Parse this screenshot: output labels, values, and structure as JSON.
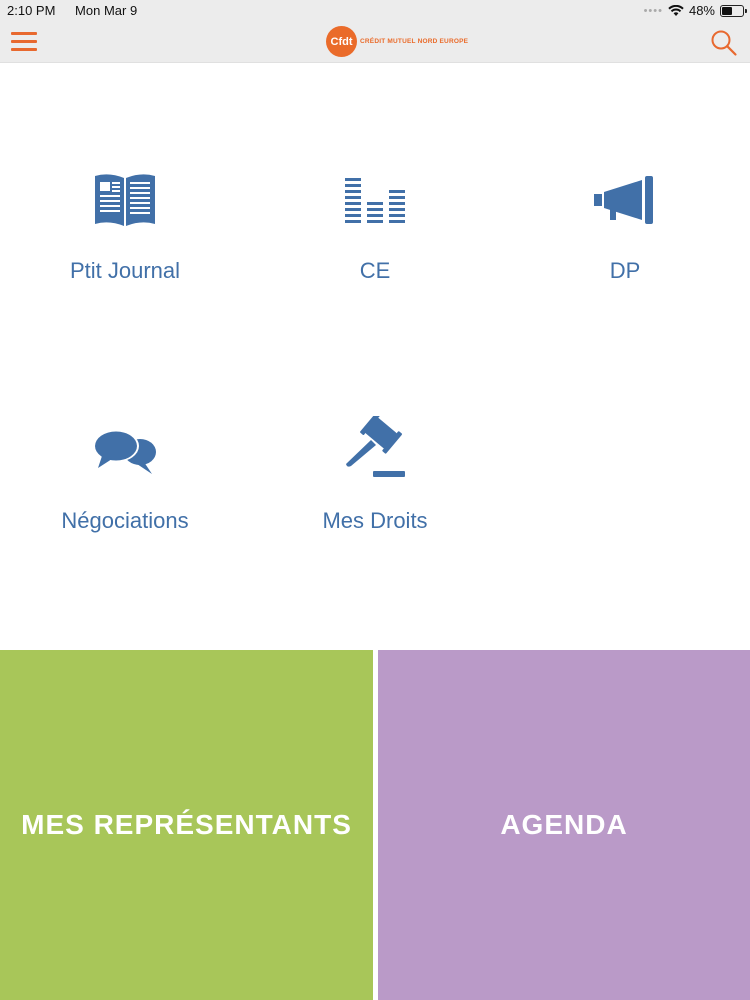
{
  "status_bar": {
    "time": "2:10 PM",
    "date": "Mon Mar 9",
    "battery": "48%",
    "battery_level": 0.48
  },
  "header": {
    "logo_badge": "Cfdt",
    "logo_text": "CRÉDIT MUTUEL NORD EUROPE",
    "menu_icon": "hamburger-icon",
    "search_icon": "search-icon"
  },
  "menu": {
    "items": [
      {
        "label": "Ptit Journal",
        "icon": "newspaper-book-icon"
      },
      {
        "label": "CE",
        "icon": "equalizer-bars-icon"
      },
      {
        "label": "DP",
        "icon": "megaphone-icon"
      },
      {
        "label": "Négociations",
        "icon": "speech-bubbles-icon"
      },
      {
        "label": "Mes Droits",
        "icon": "gavel-icon"
      }
    ]
  },
  "tiles": {
    "representatives_label": "MES REPRÉSENTANTS",
    "agenda_label": "AGENDA"
  },
  "colors": {
    "accent": "#e8692f",
    "icon_blue": "#4170a8",
    "green_tile": "#a8c659",
    "purple_tile": "#ba9ac8"
  }
}
